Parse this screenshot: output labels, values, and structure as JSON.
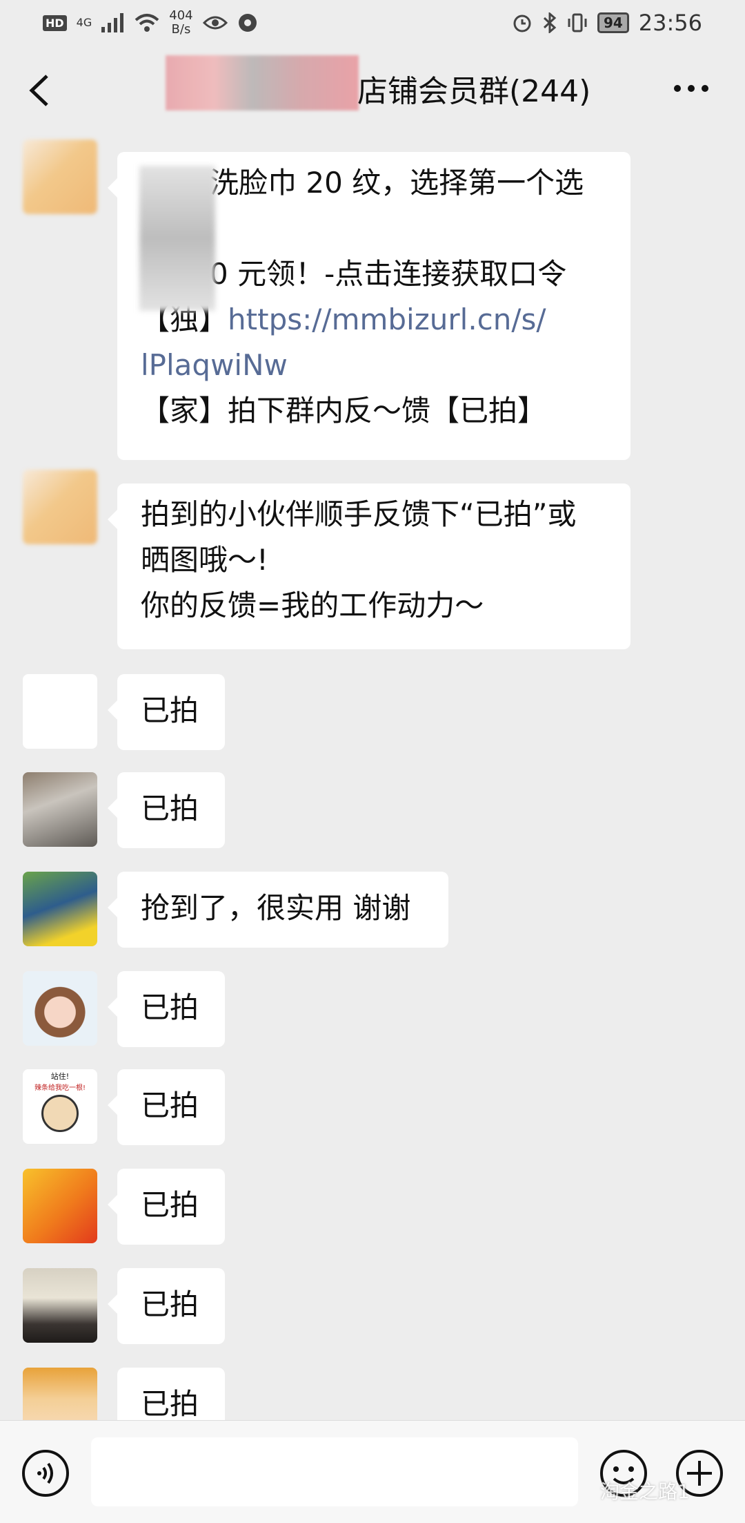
{
  "status_bar": {
    "hd": "HD",
    "network": "4G",
    "speed_value": "404",
    "speed_unit": "B/s",
    "battery": "94",
    "time": "23:56"
  },
  "header": {
    "title": "店铺会员群(244)"
  },
  "messages": [
    {
      "lines": [
        "洗脸巾 20 纹，选择第一个选",
        "",
        "0 元领！-点击连接获取口令",
        "【独】https://mmbizurl.cn/s/",
        "lPlaqwiNw",
        "【家】拍下群内反～馈【已拍】"
      ]
    },
    {
      "lines": [
        "拍到的小伙伴顺手反馈下“已拍”或",
        "晒图哦～!",
        "你的反馈=我的工作动力～"
      ]
    },
    {
      "text": "已拍"
    },
    {
      "text": "已拍"
    },
    {
      "text": "抢到了，很实用 谢谢"
    },
    {
      "text": "已拍"
    },
    {
      "text": "已拍",
      "avatar_caption_1": "站住!",
      "avatar_caption_2": "辣条给我吃一根!"
    },
    {
      "text": "已拍"
    },
    {
      "text": "已拍"
    },
    {
      "text": "已拍"
    }
  ],
  "watermark": "淘金之路1",
  "icons": [
    "back-arrow-icon",
    "more-icon",
    "voice-icon",
    "emoji-icon",
    "plus-icon"
  ]
}
